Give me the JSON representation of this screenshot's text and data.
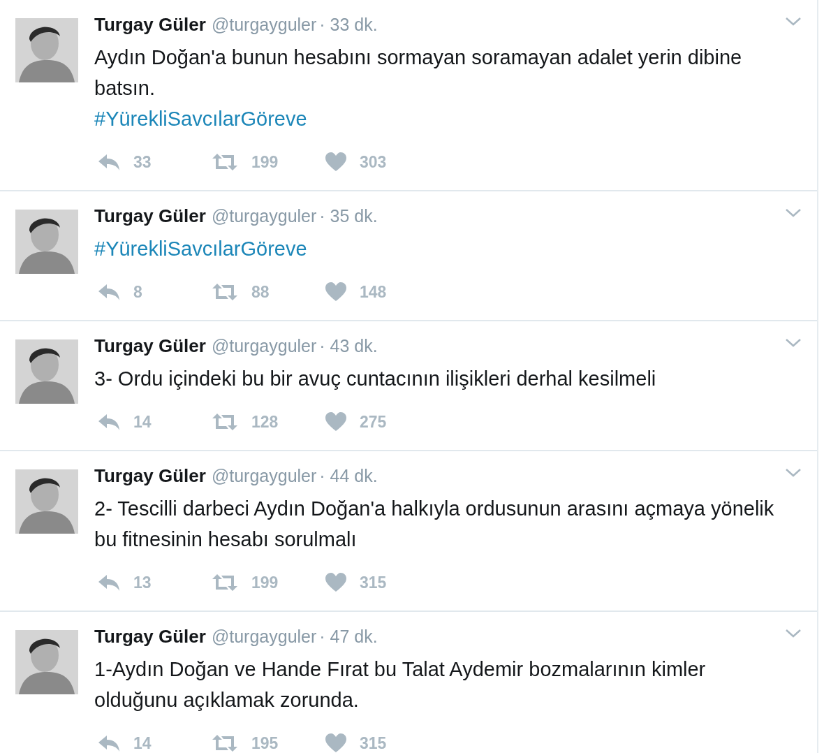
{
  "tweets": [
    {
      "name": "Turgay Güler",
      "handle": "@turgayguler",
      "time": "· 33 dk.",
      "lines": [
        {
          "kind": "text",
          "text": "Aydın Doğan'a bunun hesabını sormayan soramayan adalet yerin dibine batsın."
        },
        {
          "kind": "hashtag",
          "text": "#YürekliSavcılarGöreve"
        }
      ],
      "replies": "33",
      "retweets": "199",
      "likes": "303"
    },
    {
      "name": "Turgay Güler",
      "handle": "@turgayguler",
      "time": "· 35 dk.",
      "lines": [
        {
          "kind": "hashtag",
          "text": "#YürekliSavcılarGöreve"
        }
      ],
      "replies": "8",
      "retweets": "88",
      "likes": "148"
    },
    {
      "name": "Turgay Güler",
      "handle": "@turgayguler",
      "time": "· 43 dk.",
      "lines": [
        {
          "kind": "text",
          "text": "3- Ordu içindeki bu bir avuç cuntacının ilişikleri derhal kesilmeli"
        }
      ],
      "replies": "14",
      "retweets": "128",
      "likes": "275"
    },
    {
      "name": "Turgay Güler",
      "handle": "@turgayguler",
      "time": "· 44 dk.",
      "lines": [
        {
          "kind": "text",
          "text": "2- Tescilli darbeci Aydın Doğan'a halkıyla ordusunun arasını açmaya yönelik bu fitnesinin hesabı sorulmalı"
        }
      ],
      "replies": "13",
      "retweets": "199",
      "likes": "315"
    },
    {
      "name": "Turgay Güler",
      "handle": "@turgayguler",
      "time": "· 47 dk.",
      "lines": [
        {
          "kind": "text",
          "text": "1-Aydın Doğan ve Hande Fırat bu Talat Aydemir bozmalarının kimler olduğunu açıklamak zorunda."
        }
      ],
      "replies": "14",
      "retweets": "195",
      "likes": "315"
    }
  ]
}
